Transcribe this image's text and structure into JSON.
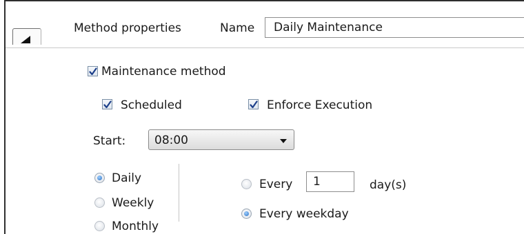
{
  "header": {
    "section_title": "Method properties",
    "name_label": "Name",
    "name_value": "Daily Maintenance"
  },
  "options": {
    "maintenance_method": {
      "label": "Maintenance method",
      "checked": true
    },
    "scheduled": {
      "label": "Scheduled",
      "checked": true
    },
    "enforce_execution": {
      "label": "Enforce Execution",
      "checked": true
    }
  },
  "start": {
    "label": "Start:",
    "value": "08:00"
  },
  "frequency": {
    "selected": "Daily",
    "options": [
      "Daily",
      "Weekly",
      "Monthly"
    ]
  },
  "daily": {
    "every_label": "Every",
    "every_value": "1",
    "unit_label": "day(s)",
    "weekday_label": "Every weekday",
    "selected": "Every weekday"
  },
  "icons": {
    "collapse": "collapse-triangle-icon",
    "checkmark": "checkmark-icon",
    "dropdown": "chevron-down-icon"
  },
  "colors": {
    "accent": "#2b6fc2",
    "check": "#1c3f8a"
  }
}
